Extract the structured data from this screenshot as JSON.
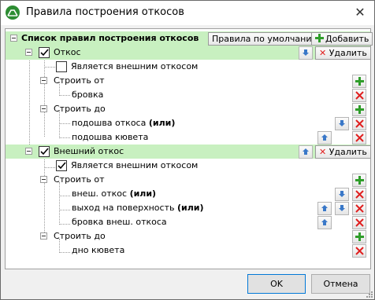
{
  "window": {
    "title": "Правила построения откосов",
    "close_glyph": "✕",
    "app_icon": "slope-app-icon"
  },
  "root": {
    "label": "Список правил построения откосов",
    "default_button": "Правила по умолчанию",
    "add_button": "Добавить"
  },
  "rules": [
    {
      "name": "Откос",
      "checked": true,
      "delete_button": "Удалить",
      "external_label": "Является внешним откосом",
      "external_checked": false,
      "from_label": "Строить от",
      "from_items": [
        {
          "text": "бровка",
          "suffix": ""
        }
      ],
      "to_label": "Строить до",
      "to_items": [
        {
          "text": "подошва откоса",
          "suffix": "(или)"
        },
        {
          "text": "подошва кювета",
          "suffix": ""
        }
      ]
    },
    {
      "name": "Внешний откос",
      "checked": true,
      "delete_button": "Удалить",
      "external_label": "Является внешним откосом",
      "external_checked": true,
      "from_label": "Строить от",
      "from_items": [
        {
          "text": "внеш. откос",
          "suffix": "(или)"
        },
        {
          "text": "выход на поверхность",
          "suffix": "(или)"
        },
        {
          "text": "бровка внеш. откоса",
          "suffix": ""
        }
      ],
      "to_label": "Строить до",
      "to_items": [
        {
          "text": "дно кювета",
          "suffix": ""
        }
      ]
    }
  ],
  "footer": {
    "ok": "OK",
    "cancel": "Отмена"
  },
  "colors": {
    "highlight": "#c8f0c0",
    "add_green": "#2f9d2a",
    "delete_red": "#e02020",
    "arrow_blue": "#3a78c8"
  }
}
